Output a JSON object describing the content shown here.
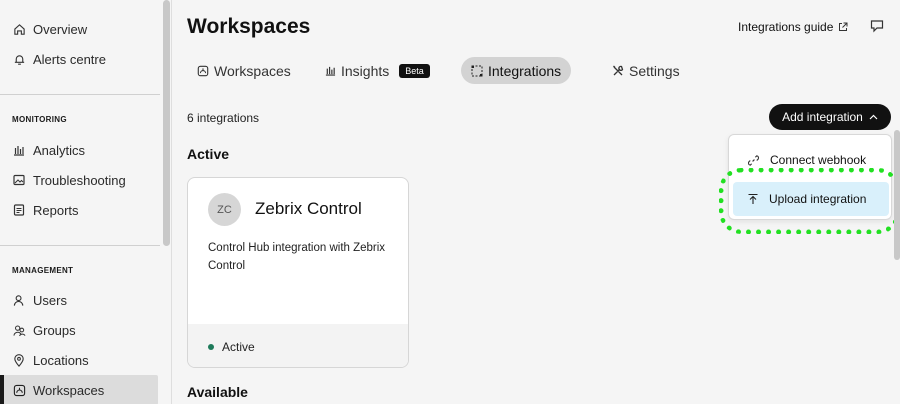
{
  "sidebar": {
    "top_items": [
      {
        "label": "Overview",
        "icon": "home-icon"
      },
      {
        "label": "Alerts centre",
        "icon": "bell-icon"
      }
    ],
    "monitoring_title": "MONITORING",
    "monitoring_items": [
      {
        "label": "Analytics",
        "icon": "bar-chart-icon"
      },
      {
        "label": "Troubleshooting",
        "icon": "image-icon"
      },
      {
        "label": "Reports",
        "icon": "document-icon"
      }
    ],
    "management_title": "MANAGEMENT",
    "management_items": [
      {
        "label": "Users",
        "icon": "user-icon"
      },
      {
        "label": "Groups",
        "icon": "group-icon"
      },
      {
        "label": "Locations",
        "icon": "location-pin-icon"
      },
      {
        "label": "Workspaces",
        "icon": "workspace-icon",
        "selected": true
      }
    ]
  },
  "header": {
    "title": "Workspaces",
    "guide_label": "Integrations guide"
  },
  "tabs": [
    {
      "label": "Workspaces",
      "icon": "workspace-icon"
    },
    {
      "label": "Insights",
      "icon": "bar-chart-icon",
      "badge": "Beta"
    },
    {
      "label": "Integrations",
      "icon": "integrations-icon",
      "active": true
    },
    {
      "label": "Settings",
      "icon": "tools-icon"
    }
  ],
  "content": {
    "count_text": "6 integrations",
    "add_button_label": "Add integration",
    "active_heading": "Active",
    "available_heading": "Available",
    "card": {
      "avatar": "ZC",
      "name": "Zebrix Control",
      "description": "Control Hub integration with Zebrix Control",
      "status": "Active"
    }
  },
  "dropdown": {
    "items": [
      {
        "label": "Connect webhook",
        "icon": "link-icon"
      },
      {
        "label": "Upload integration",
        "icon": "upload-icon",
        "highlighted": true
      }
    ]
  },
  "colors": {
    "accent_dark": "#111111",
    "status_active": "#1d7a5a",
    "dropdown_highlight": "#d9f0fb",
    "annotation_ring": "#22e022"
  }
}
